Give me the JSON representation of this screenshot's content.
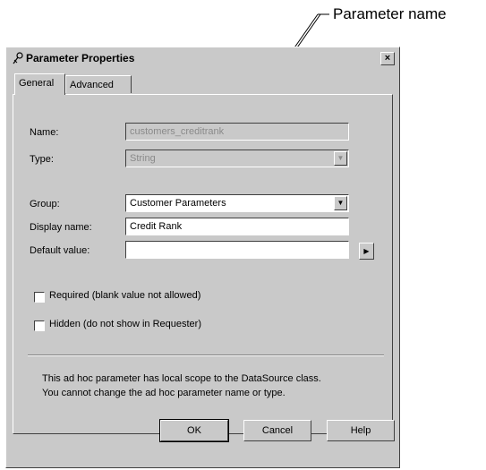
{
  "callout": {
    "label": "Parameter name"
  },
  "dialog": {
    "title": "Parameter Properties",
    "close_glyph": "×",
    "tabs": [
      {
        "label": "General"
      },
      {
        "label": "Advanced"
      }
    ],
    "fields": {
      "name": {
        "label": "Name:",
        "value": "customers_creditrank"
      },
      "type": {
        "label": "Type:",
        "value": "String"
      },
      "group": {
        "label": "Group:",
        "value": "Customer Parameters"
      },
      "display_name": {
        "label": "Display name:",
        "value": "Credit Rank"
      },
      "default_value": {
        "label": "Default value:",
        "value": ""
      }
    },
    "dropdown_glyph": "▼",
    "expand_glyph": "▶",
    "checkboxes": {
      "required": {
        "label": "Required (blank value not allowed)",
        "checked": false
      },
      "hidden": {
        "label": "Hidden (do not show in Requester)",
        "checked": false
      }
    },
    "info_lines": [
      "This ad hoc parameter has local scope to the DataSource class.",
      "You cannot change the ad hoc parameter name or type."
    ],
    "buttons": {
      "ok": "OK",
      "cancel": "Cancel",
      "help": "Help"
    }
  }
}
